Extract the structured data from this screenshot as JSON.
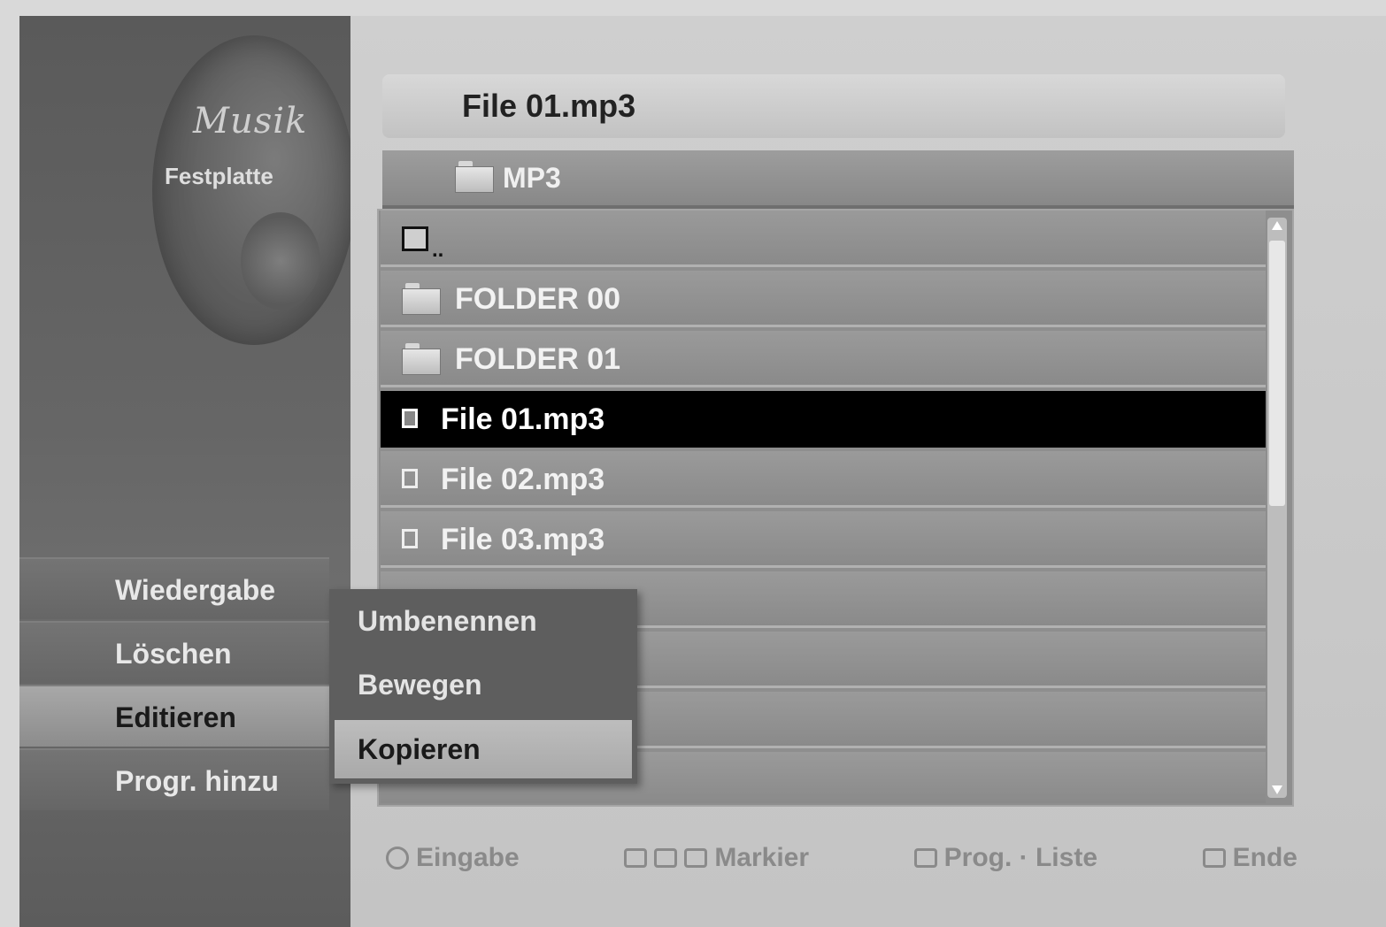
{
  "sidebar": {
    "logo_title": "Musik",
    "logo_subtitle": "Festplatte",
    "menu": [
      {
        "label": "Wiedergabe"
      },
      {
        "label": "Löschen"
      },
      {
        "label": "Editieren"
      },
      {
        "label": "Progr. hinzu"
      }
    ],
    "selected_index": 2
  },
  "submenu": {
    "items": [
      {
        "label": "Umbenennen"
      },
      {
        "label": "Bewegen"
      },
      {
        "label": "Kopieren"
      }
    ],
    "selected_index": 2
  },
  "main": {
    "current_file": "File 01.mp3",
    "current_folder": "MP3",
    "up_label": "..",
    "rows": [
      {
        "type": "up",
        "label": ".."
      },
      {
        "type": "folder",
        "label": "FOLDER 00"
      },
      {
        "type": "folder",
        "label": "FOLDER 01"
      },
      {
        "type": "file",
        "label": "File 01.mp3",
        "selected": true
      },
      {
        "type": "file",
        "label": "File 02.mp3"
      },
      {
        "type": "file",
        "label": "File 03.mp3"
      },
      {
        "type": "file",
        "label": ""
      },
      {
        "type": "file",
        "label": ""
      },
      {
        "type": "file",
        "label": ""
      },
      {
        "type": "file",
        "label": ""
      }
    ]
  },
  "footer": {
    "hints": [
      {
        "key_icon": "circle-key-icon",
        "label": "Eingabe"
      },
      {
        "key_icon": "color-keys-icon",
        "label": "Markier"
      },
      {
        "key_icon": "skip-keys-icon",
        "label": "Prog. · Liste"
      },
      {
        "key_icon": "return-key-icon",
        "label": "Ende"
      }
    ]
  },
  "colors": {
    "sidebar_bg": "#5a5a5a",
    "selected_row": "#000000",
    "list_bg": "#8e8e8e",
    "panel_bg": "#cfcfcf"
  }
}
